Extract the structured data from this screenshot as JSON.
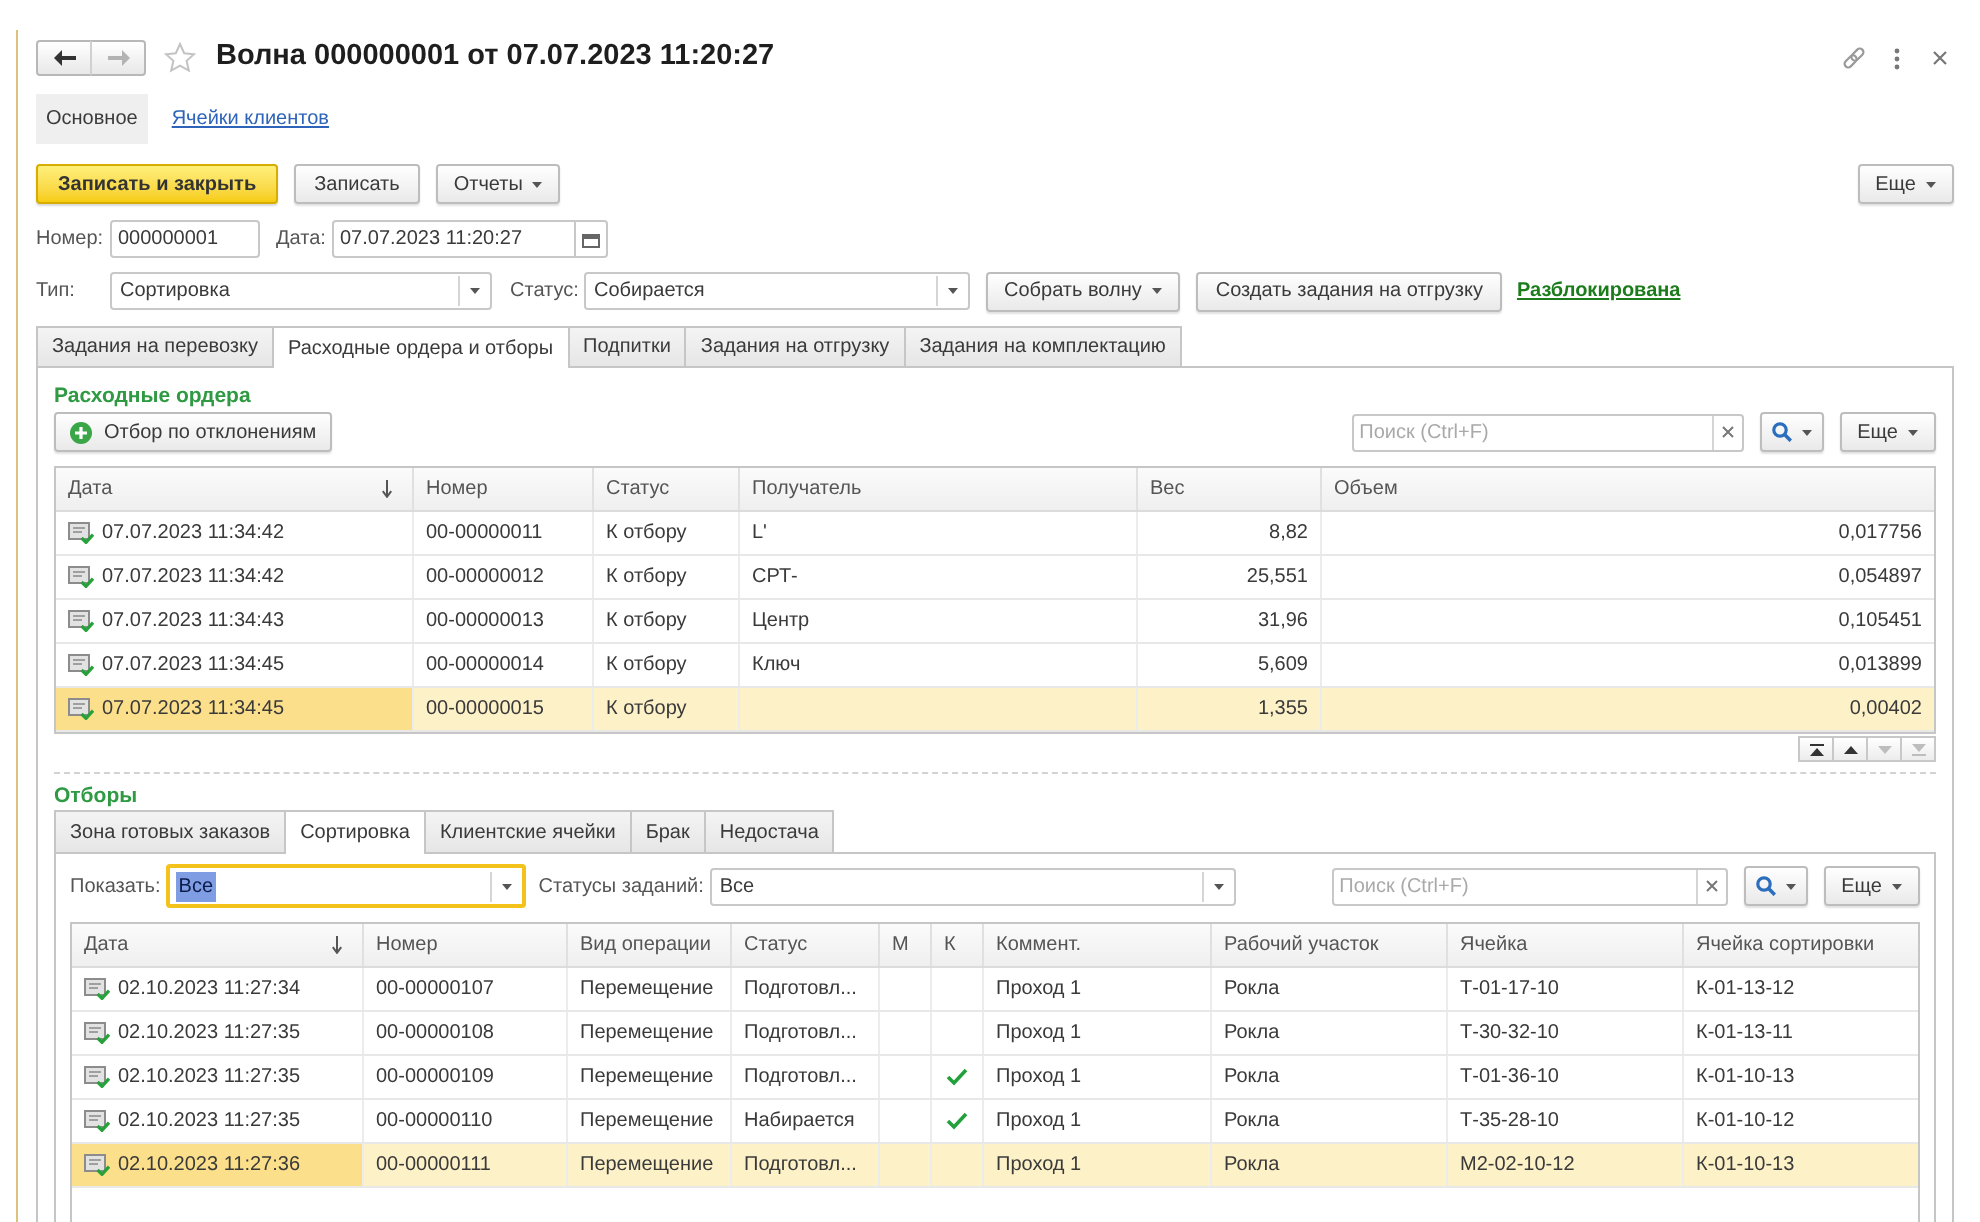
{
  "window": {
    "title": "Волна 000000001 от 07.07.2023 11:20:27",
    "favorite": false
  },
  "history": [
    {
      "kind": "back",
      "disabled": false
    },
    {
      "kind": "forward",
      "disabled": true
    }
  ],
  "form_tabs": [
    {
      "label": "Основное",
      "selected": true
    },
    {
      "label": "Ячейки клиентов",
      "selected": false
    }
  ],
  "command_bar": {
    "buttons": [
      {
        "label": "Записать и закрыть",
        "kind": "primary"
      },
      {
        "label": "Записать",
        "kind": "plain"
      },
      {
        "label": "Отчеты",
        "kind": "menu"
      }
    ],
    "more": "Еще"
  },
  "header_fields": [
    {
      "label": "Номер:",
      "value": "000000001",
      "kind": "text"
    },
    {
      "label": "Дата:",
      "value": "07.07.2023 11:20:27",
      "kind": "date"
    }
  ],
  "type_row": {
    "fields": [
      {
        "label": "Тип:",
        "value": "Сортировка"
      },
      {
        "label": "Статус:",
        "value": "Собирается"
      }
    ],
    "buttons": [
      {
        "label": "Собрать волну",
        "kind": "menu"
      },
      {
        "label": "Создать задания на отгрузку",
        "kind": "plain"
      }
    ],
    "lock_status": "Разблокирована"
  },
  "tabs": [
    {
      "label": "Задания на перевозку",
      "selected": false
    },
    {
      "label": "Расходные ордера и отборы",
      "selected": true
    },
    {
      "label": "Подпитки",
      "selected": false
    },
    {
      "label": "Задания на отгрузку",
      "selected": false
    },
    {
      "label": "Задания на комплектацию",
      "selected": false
    }
  ],
  "orders": {
    "title": "Расходные ордера",
    "filter_button": "Отбор по отклонениям",
    "search": {
      "placeholder": "Поиск (Ctrl+F)"
    },
    "more": "Еще",
    "columns": [
      {
        "label": "Дата",
        "sorted": true
      },
      {
        "label": "Номер",
        "sorted": false
      },
      {
        "label": "Статус",
        "sorted": false
      },
      {
        "label": "Получатель",
        "sorted": false
      },
      {
        "label": "Вес",
        "sorted": false
      },
      {
        "label": "Объем",
        "sorted": false
      }
    ],
    "rows": [
      {
        "date": "07.07.2023 11:34:42",
        "number": "00-00000011",
        "status": "К отбору",
        "recipient": "L'",
        "weight": "8,82",
        "volume": "0,017756",
        "selected": false
      },
      {
        "date": "07.07.2023 11:34:42",
        "number": "00-00000012",
        "status": "К отбору",
        "recipient": "СРТ-",
        "weight": "25,551",
        "volume": "0,054897",
        "selected": false
      },
      {
        "date": "07.07.2023 11:34:43",
        "number": "00-00000013",
        "status": "К отбору",
        "recipient": "Центр",
        "weight": "31,96",
        "volume": "0,105451",
        "selected": false
      },
      {
        "date": "07.07.2023 11:34:45",
        "number": "00-00000014",
        "status": "К отбору",
        "recipient": "Ключ",
        "weight": "5,609",
        "volume": "0,013899",
        "selected": false
      },
      {
        "date": "07.07.2023 11:34:45",
        "number": "00-00000015",
        "status": "К отбору",
        "weight": "1,355",
        "volume": "0,00402",
        "selected": true
      }
    ],
    "list_nav": [
      {
        "kind": "first",
        "disabled": false
      },
      {
        "kind": "up",
        "disabled": false
      },
      {
        "kind": "down",
        "disabled": true
      },
      {
        "kind": "last",
        "disabled": true
      }
    ]
  },
  "picks": {
    "title": "Отборы",
    "tabs": [
      {
        "label": "Зона готовых заказов",
        "selected": false
      },
      {
        "label": "Сортировка",
        "selected": true
      },
      {
        "label": "Клиентские ячейки",
        "selected": false
      },
      {
        "label": "Брак",
        "selected": false
      },
      {
        "label": "Недостача",
        "selected": false
      }
    ],
    "show": {
      "label": "Показать:",
      "value": "Все",
      "focused": true
    },
    "task_statuses": {
      "label": "Статусы заданий:",
      "value": "Все",
      "focused": false
    },
    "search": {
      "placeholder": "Поиск (Ctrl+F)"
    },
    "more": "Еще",
    "columns": [
      {
        "label": "Дата",
        "sorted": true
      },
      {
        "label": "Номер",
        "sorted": false
      },
      {
        "label": "Вид операции",
        "sorted": false
      },
      {
        "label": "Статус",
        "sorted": false
      },
      {
        "label": "М",
        "sorted": false
      },
      {
        "label": "К",
        "sorted": false
      },
      {
        "label": "Коммент.",
        "sorted": false
      },
      {
        "label": "Рабочий участок",
        "sorted": false
      },
      {
        "label": "Ячейка",
        "sorted": false
      },
      {
        "label": "Ячейка сортировки",
        "sorted": false
      }
    ],
    "rows": [
      {
        "date": "02.10.2023 11:27:34",
        "number": "00-00000107",
        "operation": "Перемещение",
        "status": "Подготовл...",
        "m": false,
        "k": false,
        "comment": "Проход 1",
        "work_area": "Рокла",
        "cell": "Т-01-17-10",
        "sort_cell": "К-01-13-12",
        "selected": false
      },
      {
        "date": "02.10.2023 11:27:35",
        "number": "00-00000108",
        "operation": "Перемещение",
        "status": "Подготовл...",
        "m": false,
        "k": false,
        "comment": "Проход 1",
        "work_area": "Рокла",
        "cell": "Т-30-32-10",
        "sort_cell": "К-01-13-11",
        "selected": false
      },
      {
        "date": "02.10.2023 11:27:35",
        "number": "00-00000109",
        "operation": "Перемещение",
        "status": "Подготовл...",
        "m": false,
        "k": true,
        "comment": "Проход 1",
        "work_area": "Рокла",
        "cell": "Т-01-36-10",
        "sort_cell": "К-01-10-13",
        "selected": false
      },
      {
        "date": "02.10.2023 11:27:35",
        "number": "00-00000110",
        "operation": "Перемещение",
        "status": "Набирается",
        "m": false,
        "k": true,
        "comment": "Проход 1",
        "work_area": "Рокла",
        "cell": "Т-35-28-10",
        "sort_cell": "К-01-10-12",
        "selected": false
      },
      {
        "date": "02.10.2023 11:27:36",
        "number": "00-00000111",
        "operation": "Перемещение",
        "status": "Подготовл...",
        "m": false,
        "k": false,
        "comment": "Проход 1",
        "work_area": "Рокла",
        "cell": "М2-02-10-12",
        "sort_cell": "К-01-10-13",
        "selected": true
      }
    ]
  }
}
